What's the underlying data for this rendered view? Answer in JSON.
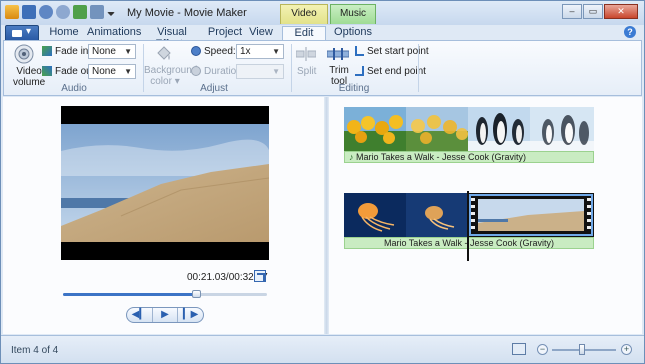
{
  "app": {
    "title": "My Movie - Movie Maker",
    "context_tabs": {
      "video_tools": "Video Tools",
      "music_tools": "Music Tools"
    },
    "window_buttons": {
      "minimize": "–",
      "maximize": "▭",
      "close": "✕"
    },
    "help": "?"
  },
  "tabs": [
    {
      "label": "Home"
    },
    {
      "label": "Animations"
    },
    {
      "label": "Visual Effects"
    },
    {
      "label": "Project"
    },
    {
      "label": "View"
    },
    {
      "label": "Edit"
    },
    {
      "label": "Options"
    }
  ],
  "ribbon": {
    "audio": {
      "group_label": "Audio",
      "video_volume_line1": "Video",
      "video_volume_line2": "volume",
      "fade_in_label": "Fade in:",
      "fade_in_value": "None",
      "fade_out_label": "Fade out:",
      "fade_out_value": "None"
    },
    "adjust": {
      "group_label": "Adjust",
      "background_line1": "Background",
      "background_line2": "color ▾",
      "speed_label": "Speed:",
      "speed_value": "1x",
      "duration_label": "Duration:",
      "duration_value": ""
    },
    "editing": {
      "group_label": "Editing",
      "split_label": "Split",
      "trim_line1": "Trim",
      "trim_line2": "tool",
      "set_start": "Set start point",
      "set_end": "Set end point"
    }
  },
  "preview": {
    "time": "00:21.03/00:32.17",
    "position_fraction": 0.65,
    "controls": {
      "prev": "◀▎",
      "play": "▶",
      "next": "▎▶"
    }
  },
  "storyboard": {
    "track1_audio": "Mario Takes a Walk - Jesse Cook (Gravity)",
    "track2_audio": "Mario Takes a Walk - Jesse Cook (Gravity)"
  },
  "status": {
    "text": "Item 4 of 4",
    "zoom_minus": "−",
    "zoom_plus": "+"
  },
  "colors": {
    "accent": "#3c74c6",
    "video_tools_tab": "#e2e28a",
    "music_tools_tab": "#9fdc95",
    "audio_track": "#c9ecc2"
  }
}
